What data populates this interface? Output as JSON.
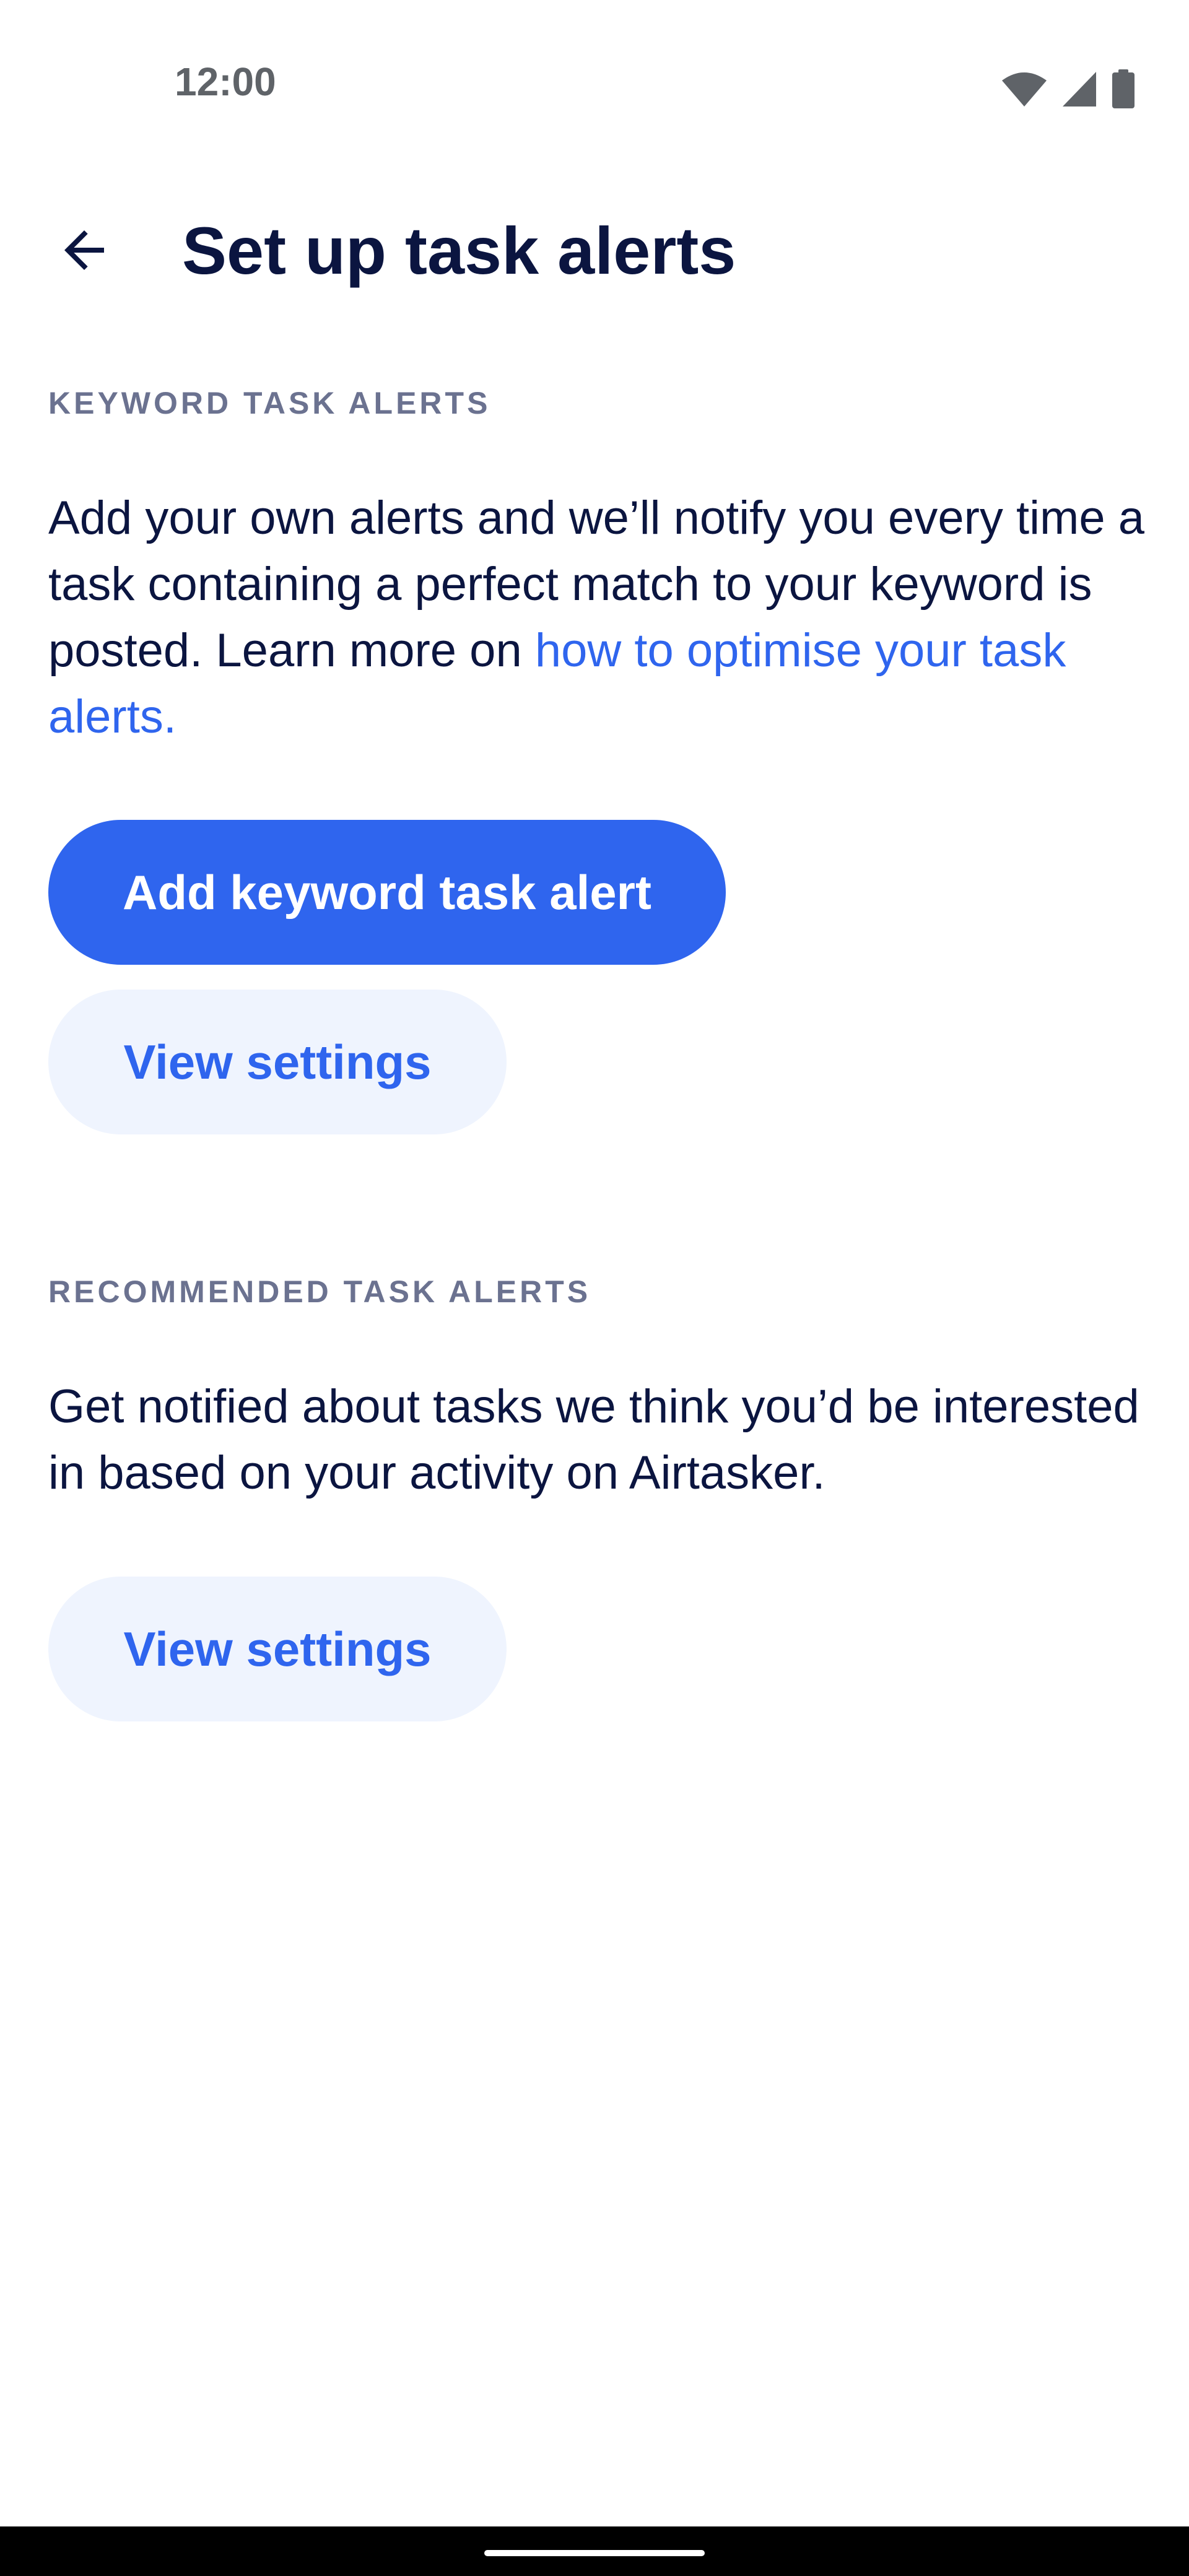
{
  "status_bar": {
    "time": "12:00",
    "icons": [
      "wifi-icon",
      "cellular-signal-icon",
      "battery-icon"
    ]
  },
  "header": {
    "back_icon": "arrow-back-icon",
    "title": "Set up task alerts"
  },
  "keyword_section": {
    "label": "KEYWORD TASK ALERTS",
    "description": "Add your own alerts and we’ll notify you every time a task containing a perfect match to your keyword is posted. Learn more on ",
    "link_text": "how to optimise your task alerts.",
    "primary_button": "Add keyword task alert",
    "secondary_button": "View settings"
  },
  "recommended_section": {
    "label": "RECOMMENDED TASK ALERTS",
    "description": "Get notified about tasks we think you’d be interested in based on your activity on Airtasker.",
    "secondary_button": "View settings"
  },
  "colors": {
    "primary": "#2f65ee",
    "primary_light": "#eff4fe",
    "text_dark": "#0b1540",
    "text_muted": "#6b7290",
    "background": "#ffffff"
  }
}
